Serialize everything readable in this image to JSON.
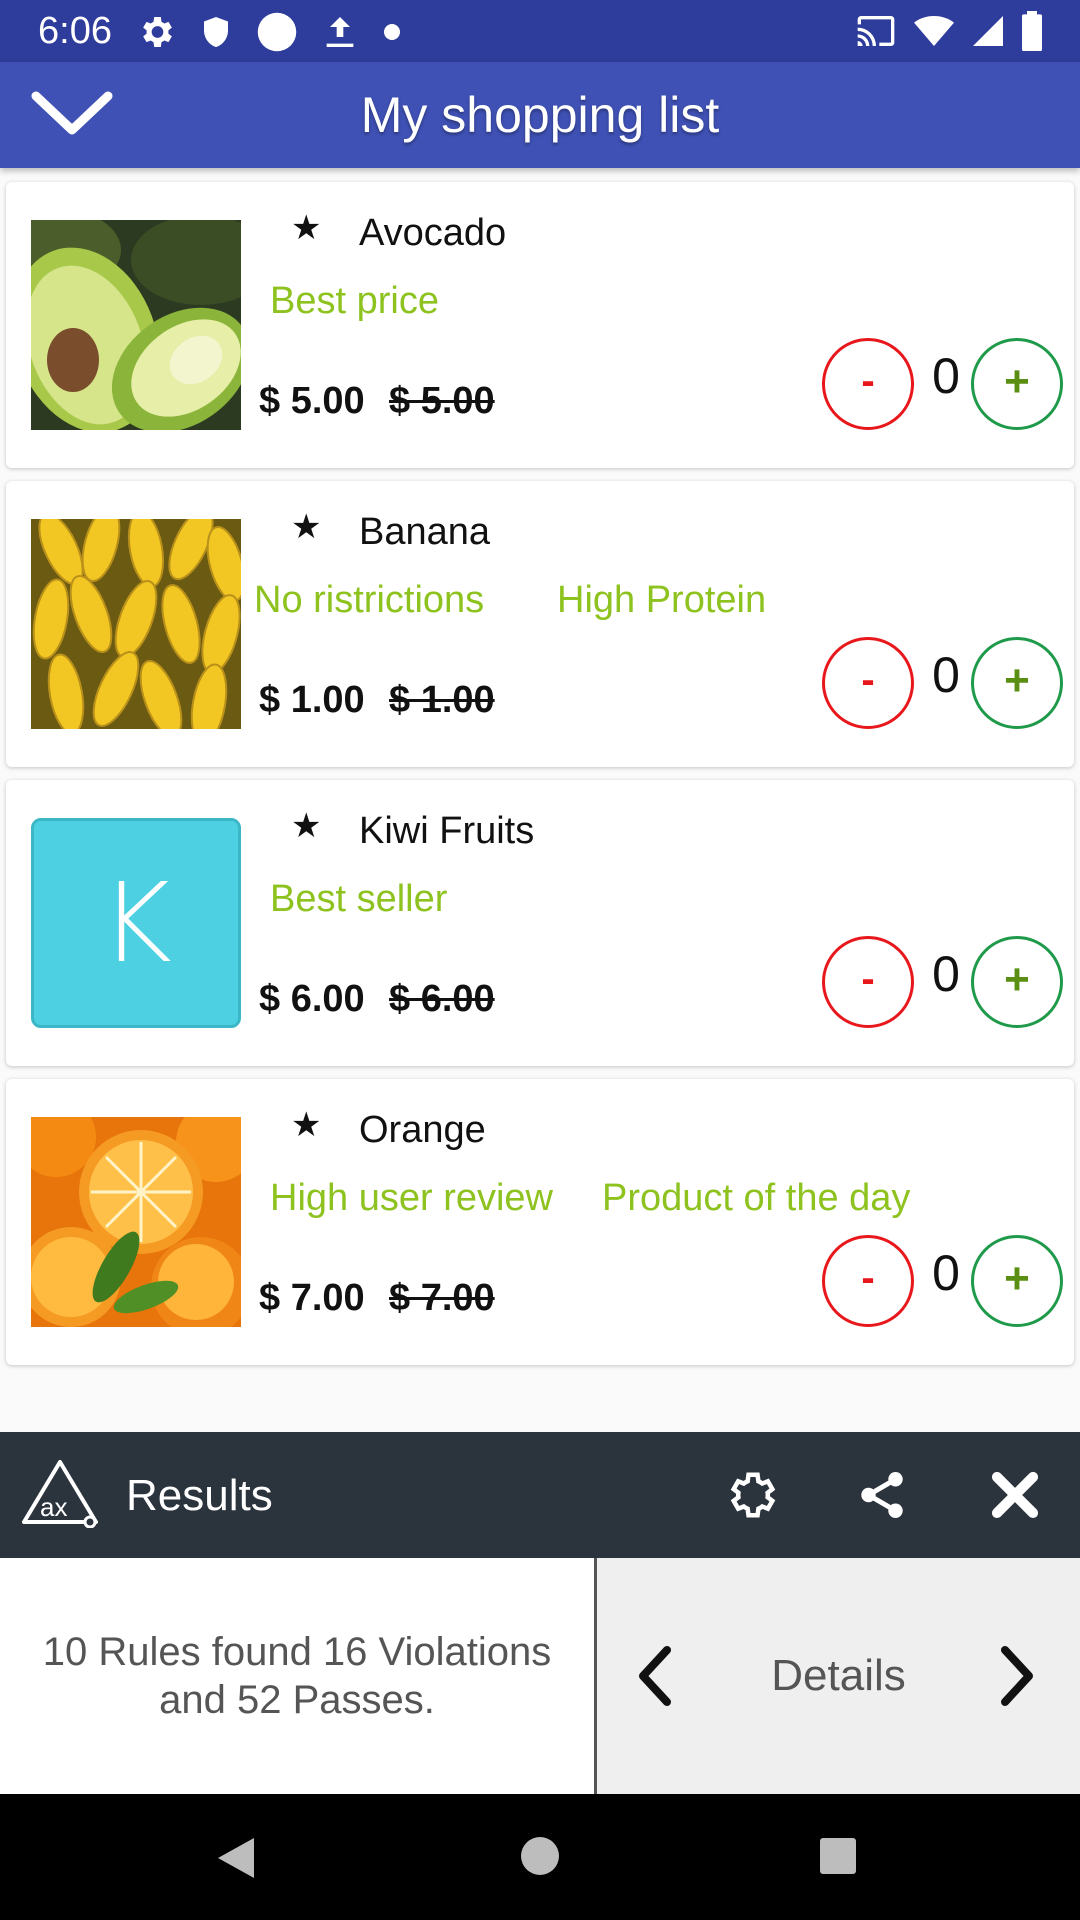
{
  "status_bar": {
    "time": "6:06"
  },
  "app_bar": {
    "title": "My shopping list"
  },
  "products": [
    {
      "name": "Avocado",
      "tags": [
        "Best price"
      ],
      "price": "$ 5.00",
      "old_price": "$ 5.00",
      "quantity": "0",
      "image": "avocado-image"
    },
    {
      "name": "Banana",
      "tags": [
        "No ristrictions",
        "High Protein"
      ],
      "price": "$ 1.00",
      "old_price": "$ 1.00",
      "quantity": "0",
      "image": "banana-image"
    },
    {
      "name": "Kiwi Fruits",
      "tags": [
        "Best seller"
      ],
      "price": "$ 6.00",
      "old_price": "$ 6.00",
      "quantity": "0",
      "image_letter": "K"
    },
    {
      "name": "Orange",
      "tags": [
        "High user review",
        "Product of the day"
      ],
      "price": "$ 7.00",
      "old_price": "$ 7.00",
      "quantity": "0",
      "image": "orange-image"
    }
  ],
  "buttons": {
    "minus": "-",
    "plus": "+"
  },
  "results_panel": {
    "title": "Results",
    "summary": "10 Rules found 16 Violations and 52 Passes.",
    "details_label": "Details"
  },
  "colors": {
    "status_bar": "#2e3c9b",
    "app_bar": "#3f51b5",
    "tag_green": "#8dc21f",
    "minus_red": "#e8171b",
    "plus_green": "#1f9a4a",
    "results_bar": "#2b333d",
    "kiwi_tile": "#4dd0e1"
  }
}
